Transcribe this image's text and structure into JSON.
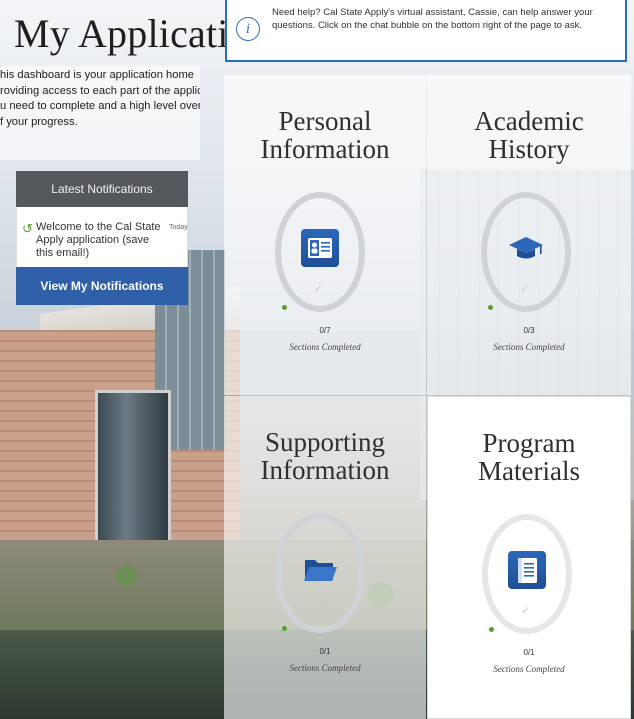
{
  "page": {
    "title": "My Application",
    "intro_lines": [
      "his dashboard is your application home",
      "roviding access to each part of the application",
      "u need to complete and a high level overview",
      "f your progress."
    ]
  },
  "help_banner": {
    "text": "Need help? Cal State Apply's virtual assistant, Cassie, can help answer your questions. Click on the chat bubble on the bottom right of the page to ask.",
    "icon": "info-icon"
  },
  "notifications": {
    "header": "Latest Notifications",
    "items": [
      {
        "text": "Welcome to the Cal State Apply application (save this email!)",
        "time": "Today",
        "icon": "notification-icon"
      }
    ],
    "button_label": "View My Notifications"
  },
  "tiles": [
    {
      "title_lines": [
        "Personal",
        "Information"
      ],
      "count": "0/7",
      "sections_label": "Sections Completed",
      "icon": "id-card-icon"
    },
    {
      "title_lines": [
        "Academic",
        "History"
      ],
      "count": "0/3",
      "sections_label": "Sections Completed",
      "icon": "graduation-cap-icon"
    },
    {
      "title_lines": [
        "Supporting",
        "Information"
      ],
      "count": "0/1",
      "sections_label": "Sections Completed",
      "icon": "folder-icon"
    },
    {
      "title_lines": [
        "Program",
        "Materials"
      ],
      "count": "0/1",
      "sections_label": "Sections Completed",
      "icon": "book-icon"
    }
  ],
  "colors": {
    "accent_blue": "#2e5fa8",
    "progress_green": "#5aa02c",
    "notification_header": "#54585c"
  }
}
